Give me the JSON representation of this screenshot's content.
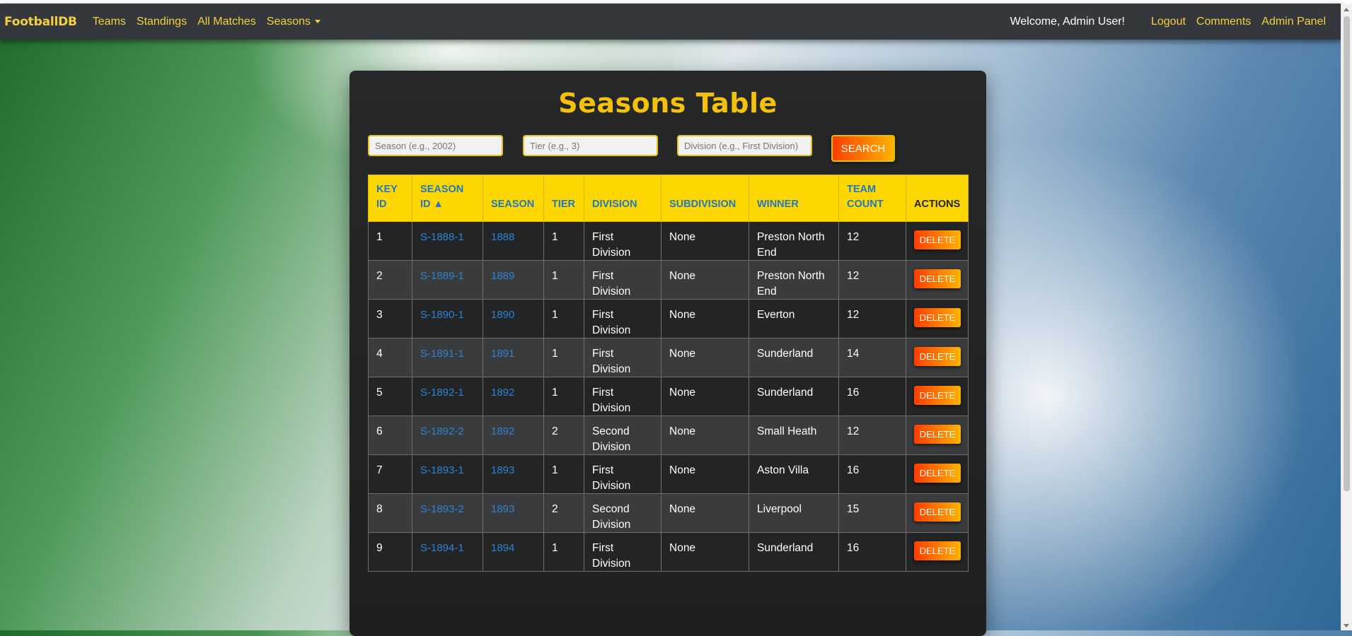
{
  "nav": {
    "brand": "FootballDB",
    "links": [
      "Teams",
      "Standings",
      "All Matches"
    ],
    "seasons_label": "Seasons",
    "welcome": "Welcome, Admin User!",
    "right_links": [
      "Logout",
      "Comments",
      "Admin Panel"
    ]
  },
  "page": {
    "title": "Seasons Table"
  },
  "search": {
    "season_placeholder": "Season (e.g., 2002)",
    "tier_placeholder": "Tier (e.g., 3)",
    "division_placeholder": "Division (e.g., First Division)",
    "button_label": "SEARCH"
  },
  "table": {
    "headers": [
      "KEY ID",
      "SEASON ID ▲",
      "SEASON",
      "TIER",
      "DIVISION",
      "SUBDIVISION",
      "WINNER",
      "TEAM COUNT",
      "ACTIONS"
    ],
    "delete_label": "DELETE",
    "rows": [
      {
        "key_id": "1",
        "season_id": "S-1888-1",
        "season": "1888",
        "tier": "1",
        "division": "First Division",
        "subdivision": "None",
        "winner": "Preston North End",
        "team_count": "12"
      },
      {
        "key_id": "2",
        "season_id": "S-1889-1",
        "season": "1889",
        "tier": "1",
        "division": "First Division",
        "subdivision": "None",
        "winner": "Preston North End",
        "team_count": "12"
      },
      {
        "key_id": "3",
        "season_id": "S-1890-1",
        "season": "1890",
        "tier": "1",
        "division": "First Division",
        "subdivision": "None",
        "winner": "Everton",
        "team_count": "12"
      },
      {
        "key_id": "4",
        "season_id": "S-1891-1",
        "season": "1891",
        "tier": "1",
        "division": "First Division",
        "subdivision": "None",
        "winner": "Sunderland",
        "team_count": "14"
      },
      {
        "key_id": "5",
        "season_id": "S-1892-1",
        "season": "1892",
        "tier": "1",
        "division": "First Division",
        "subdivision": "None",
        "winner": "Sunderland",
        "team_count": "16"
      },
      {
        "key_id": "6",
        "season_id": "S-1892-2",
        "season": "1892",
        "tier": "2",
        "division": "Second Division",
        "subdivision": "None",
        "winner": "Small Heath",
        "team_count": "12"
      },
      {
        "key_id": "7",
        "season_id": "S-1893-1",
        "season": "1893",
        "tier": "1",
        "division": "First Division",
        "subdivision": "None",
        "winner": "Aston Villa",
        "team_count": "16"
      },
      {
        "key_id": "8",
        "season_id": "S-1893-2",
        "season": "1893",
        "tier": "2",
        "division": "Second Division",
        "subdivision": "None",
        "winner": "Liverpool",
        "team_count": "15"
      },
      {
        "key_id": "9",
        "season_id": "S-1894-1",
        "season": "1894",
        "tier": "1",
        "division": "First Division",
        "subdivision": "None",
        "winner": "Sunderland",
        "team_count": "16"
      }
    ]
  }
}
